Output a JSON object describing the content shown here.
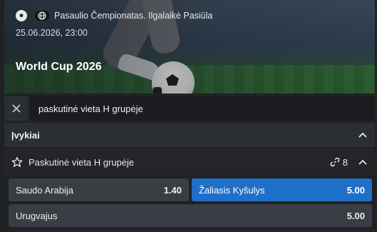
{
  "hero": {
    "breadcrumb": "Pasaulio Čempionatas. Ilgalaikė Pasiūla",
    "datetime": "25.06.2026, 23:00",
    "title": "World Cup 2026"
  },
  "search": {
    "value": "paskutinė vieta H grupėje"
  },
  "events": {
    "label": "Įvykiai"
  },
  "market": {
    "label": "Paskutinė vieta H grupėje",
    "links_count": "8"
  },
  "outcomes": [
    {
      "name": "Saudo Arabija",
      "odd": "1.40",
      "selected": false
    },
    {
      "name": "Žaliasis Kyšulys",
      "odd": "5.00",
      "selected": true
    },
    {
      "name": "Urugvajus",
      "odd": "5.00",
      "selected": false
    }
  ],
  "colors": {
    "background": "#1f2125",
    "selected": "#1f6fc9",
    "outcome": "#3a3d43"
  },
  "icons": {
    "sport": "soccer-ball-icon",
    "region": "globe-icon",
    "close": "close-icon",
    "collapse": "chevron-up-icon",
    "favorite": "star-icon",
    "links": "link-icon"
  }
}
